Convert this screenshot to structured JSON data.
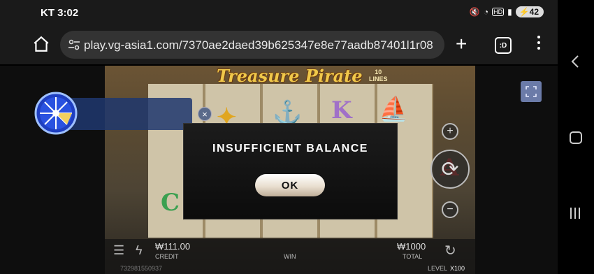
{
  "status": {
    "carrier": "KT",
    "time": "3:02",
    "battery": "42"
  },
  "browser": {
    "url": "play.vg-asia1.com/7370ae2daed39b625347e8e77aadb87401l1r08",
    "tab_icon_label": ":D"
  },
  "game": {
    "logo": "Treasure Pirate",
    "lines_label": "10\nLINES",
    "credit_value": "₩111.00",
    "credit_label": "CREDIT",
    "win_label": "WIN",
    "total_value": "₩1000",
    "total_label": "TOTAL",
    "session_id": "732981550937",
    "level_label": "LEVEL",
    "level_value": "X100"
  },
  "dialog": {
    "message": "INSUFFICIENT BALANCE",
    "ok_label": "OK"
  },
  "colors": {
    "accent": "#6b7ba8",
    "popup_bg": "#141414"
  }
}
